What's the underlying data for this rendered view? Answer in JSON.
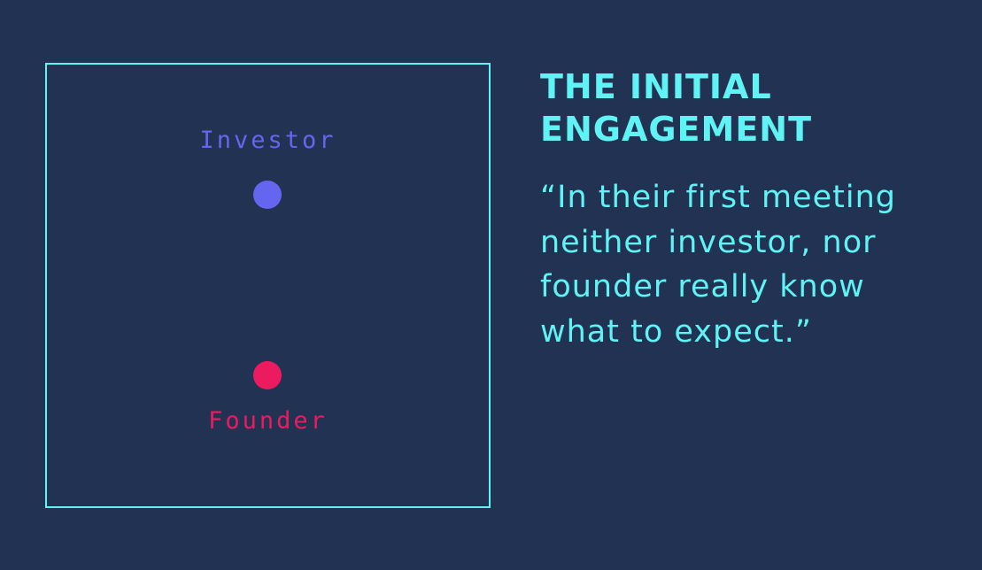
{
  "diagram": {
    "nodes": [
      {
        "label": "Investor",
        "color": "#6466f0",
        "role": "top"
      },
      {
        "label": "Founder",
        "color": "#ec1b60",
        "role": "bottom"
      }
    ],
    "frame_color": "#5ff3f5"
  },
  "text": {
    "heading_lines": [
      "THE INITIAL",
      "ENGAGEMENT"
    ],
    "quote_lines": [
      "“In their first meeting",
      "neither investor, nor",
      "founder really know",
      "what to expect.”"
    ],
    "color": "#5ff3f5"
  },
  "background": "#223252"
}
